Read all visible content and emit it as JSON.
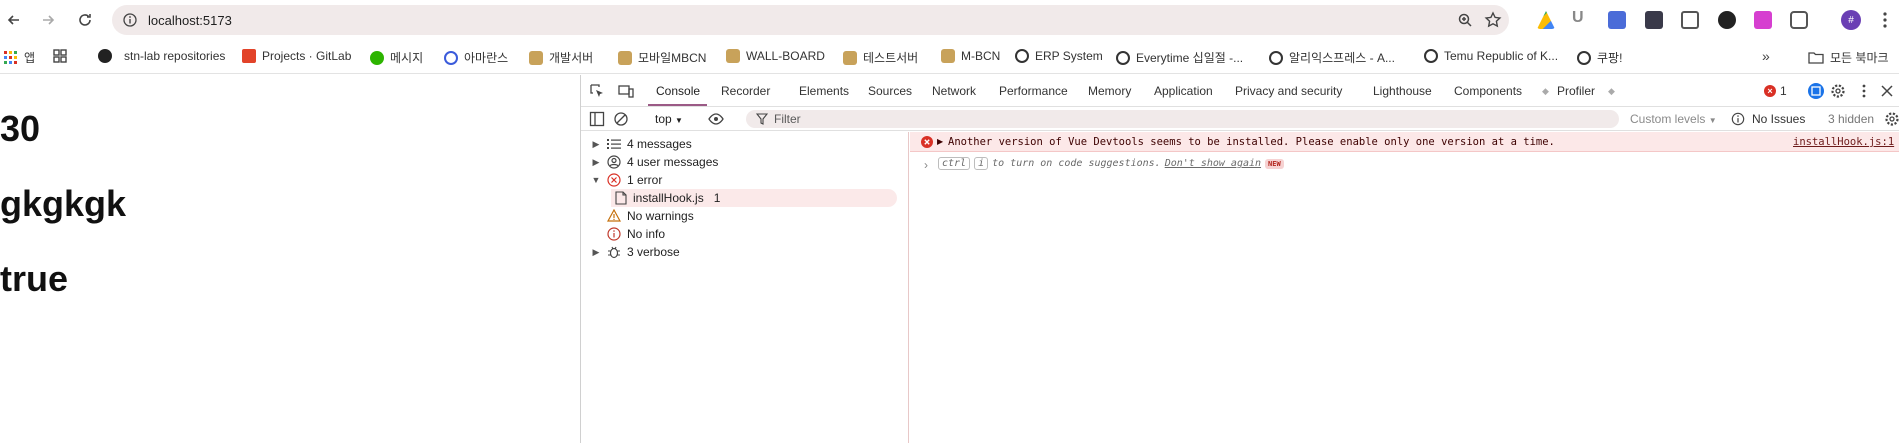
{
  "browser": {
    "url": "localhost:5173",
    "avatar_letter": "#"
  },
  "bookmarks": {
    "apps_label": "앱",
    "items": [
      {
        "label": "stn-lab repositories",
        "icon": "github-icon"
      },
      {
        "label": "Projects · GitLab",
        "icon": "gitlab-icon"
      },
      {
        "label": "메시지",
        "icon": "message-icon"
      },
      {
        "label": "아마란스",
        "icon": "amaranth-icon"
      },
      {
        "label": "개발서버",
        "icon": "dev-server-icon"
      },
      {
        "label": "모바일MBCN",
        "icon": "mbcn-icon"
      },
      {
        "label": "WALL-BOARD",
        "icon": "wallboard-icon"
      },
      {
        "label": "테스트서버",
        "icon": "test-server-icon"
      },
      {
        "label": "M-BCN",
        "icon": "mbcn2-icon"
      },
      {
        "label": "ERP System",
        "icon": "globe-icon"
      },
      {
        "label": "Everytime 십일절 -...",
        "icon": "globe-icon"
      },
      {
        "label": "알리익스프레스 - A...",
        "icon": "globe-icon"
      },
      {
        "label": "Temu Republic of K...",
        "icon": "globe-icon"
      },
      {
        "label": "쿠팡!",
        "icon": "globe-icon"
      }
    ],
    "all_bookmarks": "모든 북마크"
  },
  "page": {
    "values": [
      "30",
      "gkgkgk",
      "true"
    ]
  },
  "devtools": {
    "tabs": [
      "Console",
      "Recorder",
      "Elements",
      "Sources",
      "Network",
      "Performance",
      "Memory",
      "Application",
      "Privacy and security",
      "Lighthouse",
      "Components",
      "Profiler"
    ],
    "error_count": "1",
    "context": "top",
    "filter_placeholder": "Filter",
    "levels": "Custom levels",
    "issues": "No Issues",
    "hidden": "3 hidden",
    "sidebar": [
      {
        "label": "4 messages",
        "icon": "list-icon",
        "expandable": true
      },
      {
        "label": "4 user messages",
        "icon": "user-icon",
        "expandable": true
      },
      {
        "label": "1 error",
        "icon": "error-icon",
        "expandable": true,
        "expanded": true
      },
      {
        "label": "installHook.js",
        "count": "1",
        "icon": "file-icon",
        "selected": true
      },
      {
        "label": "No warnings",
        "icon": "warning-icon"
      },
      {
        "label": "No info",
        "icon": "info-icon"
      },
      {
        "label": "3 verbose",
        "icon": "bug-icon",
        "expandable": true
      }
    ],
    "console": {
      "error_text": "Another version of Vue Devtools seems to be installed. Please enable only one version at a time.",
      "error_source": "installHook.js:1",
      "hint_key1": "ctrl",
      "hint_key2": "i",
      "hint_text": "to turn on code suggestions.",
      "hint_link": "Don't show again",
      "hint_badge": "NEW"
    }
  },
  "colors": {
    "accent": "#9b5a86",
    "error": "#d93025",
    "error_bg": "#fce8e8"
  }
}
